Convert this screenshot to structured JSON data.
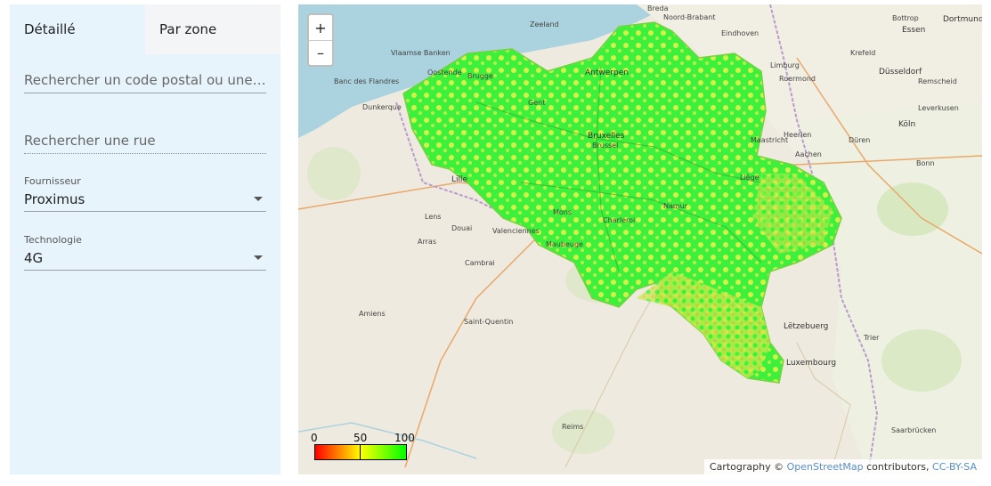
{
  "tabs": [
    {
      "label": "Détaillé",
      "active": true
    },
    {
      "label": "Par zone",
      "active": false
    }
  ],
  "search_postal": {
    "placeholder": "Rechercher un code postal ou une commune"
  },
  "search_street": {
    "placeholder": "Rechercher une rue"
  },
  "provider": {
    "label": "Fournisseur",
    "value": "Proximus"
  },
  "technology": {
    "label": "Technologie",
    "value": "4G"
  },
  "map": {
    "zoom_in": "+",
    "zoom_out": "–",
    "legend": {
      "min": "0",
      "mid": "50",
      "max": "100"
    },
    "attribution": {
      "prefix": "Cartography ©",
      "osm": "OpenStreetMap",
      "contrib": "contributors,",
      "license": "CC-BY-SA"
    },
    "labels": {
      "antwerpen": "Antwerpen",
      "bruxelles": "Bruxelles",
      "brussel": "Brussel",
      "lille": "Lille",
      "luxembourg": "Luxembourg",
      "letzebuerg": "Lëtzebuerg",
      "maastricht": "Maastricht",
      "aachen": "Aachen",
      "koln": "Köln",
      "dusseldorf": "Düsseldorf",
      "amiens": "Amiens",
      "saint_quentin": "Saint-Quentin",
      "reims": "Reims",
      "maubeuge": "Maubeuge",
      "charleroi": "Charleroi",
      "namur": "Namur",
      "liege": "Liège",
      "mons": "Mons",
      "cambrai": "Cambrai",
      "arras": "Arras",
      "lens": "Lens",
      "douai": "Douai",
      "valenciennes": "Valenciennes",
      "dunkerque": "Dunkerque",
      "oostende": "Oostende",
      "brugge": "Brugge",
      "gent": "Gent",
      "eindhoven": "Eindhoven",
      "roermond": "Roermond",
      "heerlen": "Heerlen",
      "trier": "Trier",
      "essen": "Essen",
      "dortmund": "Dortmund",
      "krefeld": "Krefeld",
      "bonn": "Bonn",
      "leverkusen": "Leverkusen",
      "remscheid": "Remscheid",
      "duren": "Düren",
      "bottrop": "Bottrop",
      "limburg": "Limburg",
      "noord_brabant": "Noord-Brabant",
      "zeeland": "Zeeland",
      "breda": "Breda",
      "saarbrucken": "Saarbrücken",
      "vlaamse_banken": "Vlaamse Banken",
      "banc_flandres": "Banc des Flandres"
    }
  }
}
